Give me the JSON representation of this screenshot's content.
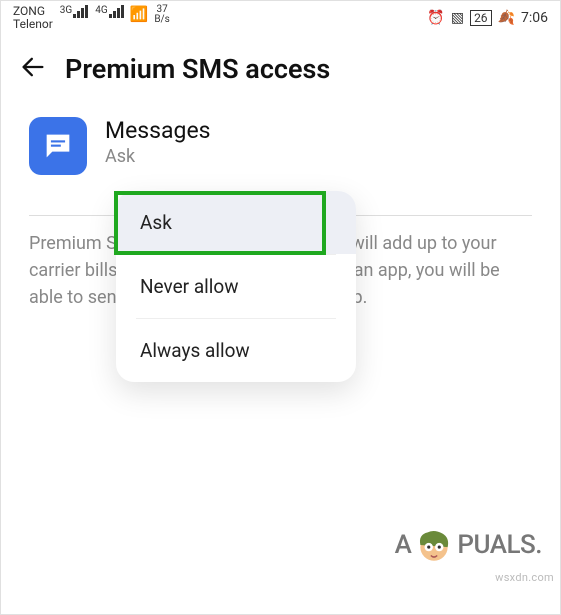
{
  "status_bar": {
    "carrier1": "ZONG",
    "carrier2": "Telenor",
    "net1": "3G",
    "net2": "4G",
    "speed_top": "37",
    "speed_bottom": "B/s",
    "battery": "26",
    "time": "7:06"
  },
  "header": {
    "title": "Premium SMS access"
  },
  "app": {
    "name": "Messages",
    "status": "Ask"
  },
  "description": "Premium SMS may cost you money and will add up to your carrier bills. If you enable permission for an app, you will be able to send premium SMS using that app.",
  "popup": {
    "option1": "Ask",
    "option2": "Never allow",
    "option3": "Always allow"
  },
  "watermark": "wsxdn.com",
  "brand_prefix": "A",
  "brand_suffix": "PUALS."
}
